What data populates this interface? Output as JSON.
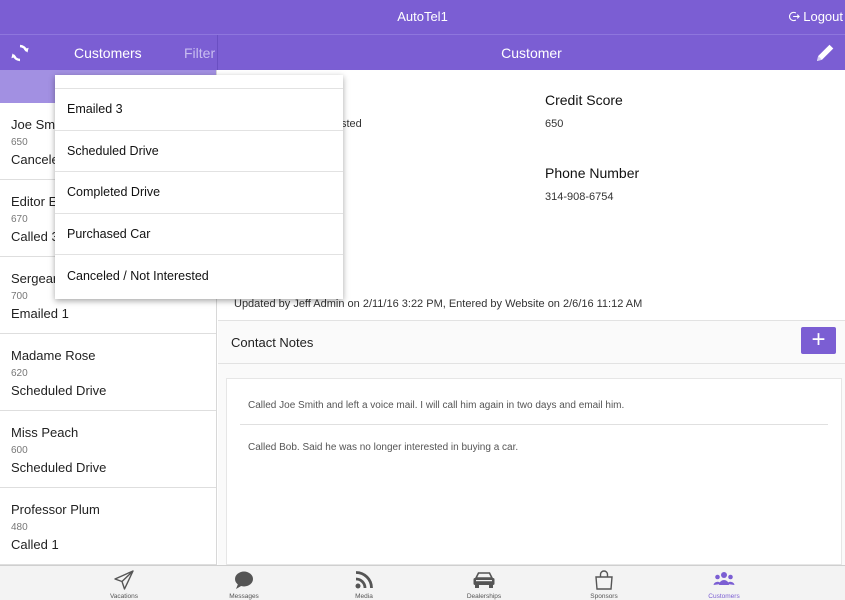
{
  "app": {
    "title": "AutoTel1",
    "logout_label": "Logout"
  },
  "nav": {
    "left_label": "Customers",
    "filter_label": "Filter",
    "right_label": "Customer"
  },
  "customers": [
    {
      "name": "Joe Sm",
      "score": "650",
      "status": "Cancele"
    },
    {
      "name": "Editor E",
      "score": "670",
      "status": "Called 3"
    },
    {
      "name": "Sergear",
      "score": "700",
      "status": "Emailed 1"
    },
    {
      "name": "Madame Rose",
      "score": "620",
      "status": "Scheduled Drive"
    },
    {
      "name": "Miss Peach",
      "score": "600",
      "status": "Scheduled Drive"
    },
    {
      "name": "Professor Plum",
      "score": "480",
      "status": "Called 1"
    }
  ],
  "detail": {
    "status_fragment": "sted",
    "credit_score_label": "Credit Score",
    "credit_score": "650",
    "phone_label": "Phone Number",
    "phone": "314-908-6754",
    "updated_text": "Updated by Jeff Admin on 2/11/16 3:22 PM, Entered by Website on 2/6/16 11:12 AM"
  },
  "notes": {
    "header": "Contact Notes",
    "add_label": "+",
    "items": [
      "Called Joe Smith and left a voice mail. I will call him again in two days and email him.",
      "Called Bob. Said he was no longer interested in buying a car."
    ]
  },
  "dropdown": {
    "options": [
      "Emailed 3",
      "Scheduled Drive",
      "Completed Drive",
      "Purchased Car",
      "Canceled / Not Interested"
    ]
  },
  "tabs": [
    {
      "label": "Vacations",
      "icon": "paper-plane-icon"
    },
    {
      "label": "Messages",
      "icon": "chat-bubble-icon"
    },
    {
      "label": "Media",
      "icon": "rss-icon"
    },
    {
      "label": "Dealerships",
      "icon": "car-icon"
    },
    {
      "label": "Sponsors",
      "icon": "shopping-bag-icon"
    },
    {
      "label": "Customers",
      "icon": "people-icon",
      "active": true
    }
  ],
  "colors": {
    "accent": "#7b5ed3",
    "sidebar_tab": "#a290e2"
  }
}
